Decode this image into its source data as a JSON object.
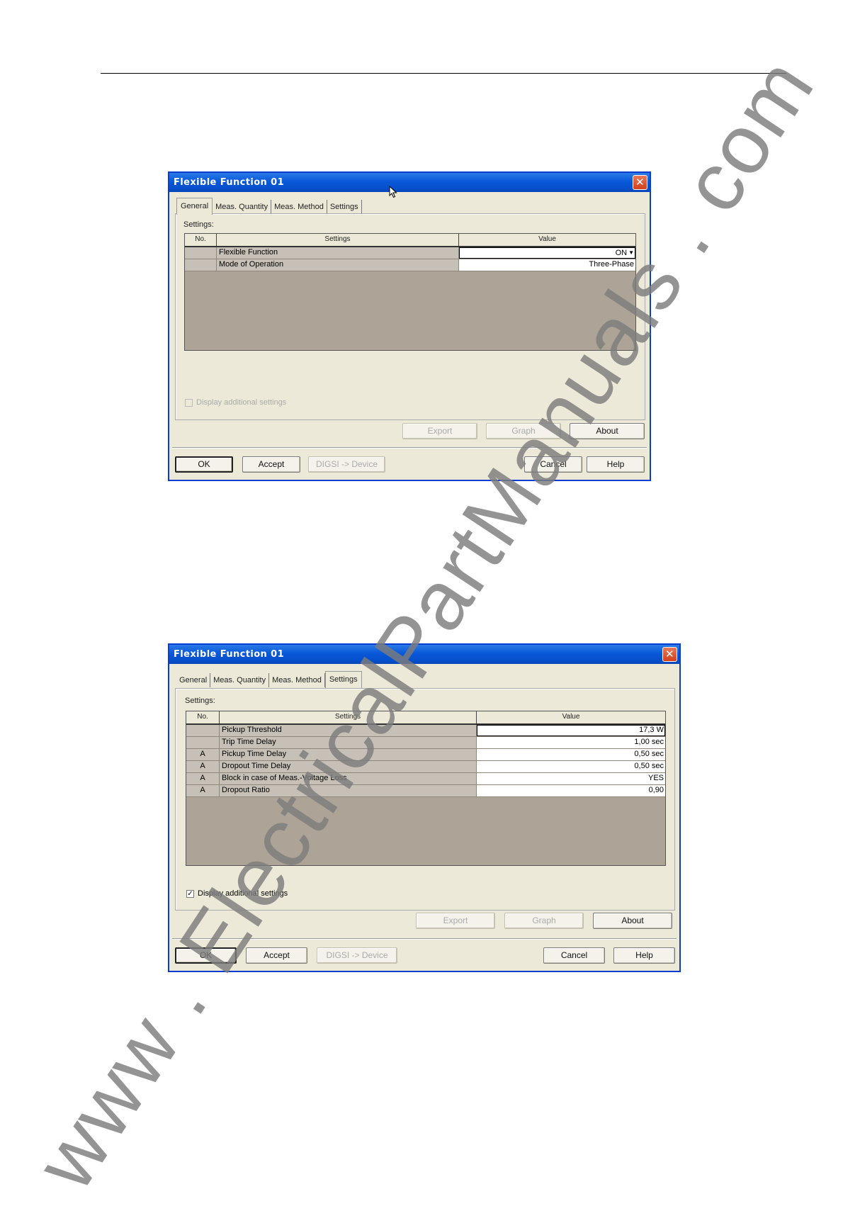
{
  "watermark": "www . ElectricalPartManuals . com",
  "dialog1": {
    "title": "Flexible Function 01",
    "tabs": [
      "General",
      "Meas. Quantity",
      "Meas. Method",
      "Settings"
    ],
    "active_tab": "General",
    "settings_label": "Settings:",
    "columns": [
      "No.",
      "Settings",
      "Value"
    ],
    "rows": [
      {
        "no": "",
        "setting": "Flexible Function",
        "value": "ON",
        "control": "combo"
      },
      {
        "no": "",
        "setting": "Mode of Operation",
        "value": "Three-Phase"
      }
    ],
    "display_additional": {
      "label": "Display additional settings",
      "checked": false,
      "enabled": false
    },
    "buttons_top": {
      "export": "Export",
      "graph": "Graph",
      "about": "About"
    },
    "buttons_bottom": {
      "ok": "OK",
      "accept": "Accept",
      "digsi": "DIGSI -> Device",
      "cancel": "Cancel",
      "help": "Help"
    }
  },
  "dialog2": {
    "title": "Flexible Function 01",
    "tabs": [
      "General",
      "Meas. Quantity",
      "Meas. Method",
      "Settings"
    ],
    "active_tab": "Settings",
    "settings_label": "Settings:",
    "columns": [
      "No.",
      "Settings",
      "Value"
    ],
    "rows": [
      {
        "no": "",
        "setting": "Pickup Threshold",
        "value": "17,3 W"
      },
      {
        "no": "",
        "setting": "Trip Time Delay",
        "value": "1,00 sec"
      },
      {
        "no": "A",
        "setting": "Pickup Time Delay",
        "value": "0,50 sec"
      },
      {
        "no": "A",
        "setting": "Dropout Time Delay",
        "value": "0,50 sec"
      },
      {
        "no": "A",
        "setting": "Block in case of Meas.-Voltage Loss",
        "value": "YES"
      },
      {
        "no": "A",
        "setting": "Dropout Ratio",
        "value": "0,90"
      }
    ],
    "display_additional": {
      "label": "Display additional settings",
      "checked": true,
      "enabled": true
    },
    "buttons_top": {
      "export": "Export",
      "graph": "Graph",
      "about": "About"
    },
    "buttons_bottom": {
      "ok": "OK",
      "accept": "Accept",
      "digsi": "DIGSI -> Device",
      "cancel": "Cancel",
      "help": "Help"
    }
  }
}
